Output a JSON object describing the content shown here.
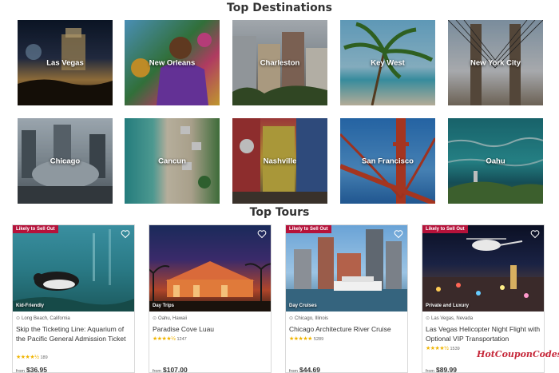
{
  "sections": {
    "destinations_title": "Top Destinations",
    "tours_title": "Top Tours"
  },
  "destinations": [
    {
      "label": "Las Vegas"
    },
    {
      "label": "New Orleans"
    },
    {
      "label": "Charleston"
    },
    {
      "label": "Key West"
    },
    {
      "label": "New York City"
    },
    {
      "label": "Chicago"
    },
    {
      "label": "Cancun"
    },
    {
      "label": "Nashville"
    },
    {
      "label": "San Francisco"
    },
    {
      "label": "Oahu"
    }
  ],
  "tours": [
    {
      "badge": "Likely to Sell Out",
      "category": "Kid-Friendly",
      "location": "Long Beach, California",
      "title": "Skip the Ticketing Line: Aquarium of the Pacific General Admission Ticket",
      "stars": "★★★★½",
      "reviews": "189",
      "from": "from",
      "price": "$36.95"
    },
    {
      "badge": "",
      "category": "Day Trips",
      "location": "Oahu, Hawaii",
      "title": "Paradise Cove Luau",
      "stars": "★★★★½",
      "reviews": "1247",
      "from": "from",
      "price": "$107.00"
    },
    {
      "badge": "Likely to Sell Out",
      "category": "Day Cruises",
      "location": "Chicago, Illinois",
      "title": "Chicago Architecture River Cruise",
      "stars": "★★★★★",
      "reviews": "5289",
      "from": "from",
      "price": "$44.69"
    },
    {
      "badge": "Likely to Sell Out",
      "category": "Private and Luxury",
      "location": "Las Vegas, Nevada",
      "title": "Las Vegas Helicopter Night Flight with Optional VIP Transportation",
      "stars": "★★★★½",
      "reviews": "1539",
      "from": "from",
      "price": "$89.99"
    }
  ],
  "watermark": "HotCouponCodes",
  "colors": {
    "badge": "#b5123a",
    "star": "#f0b400",
    "watermark": "#c6283a"
  }
}
